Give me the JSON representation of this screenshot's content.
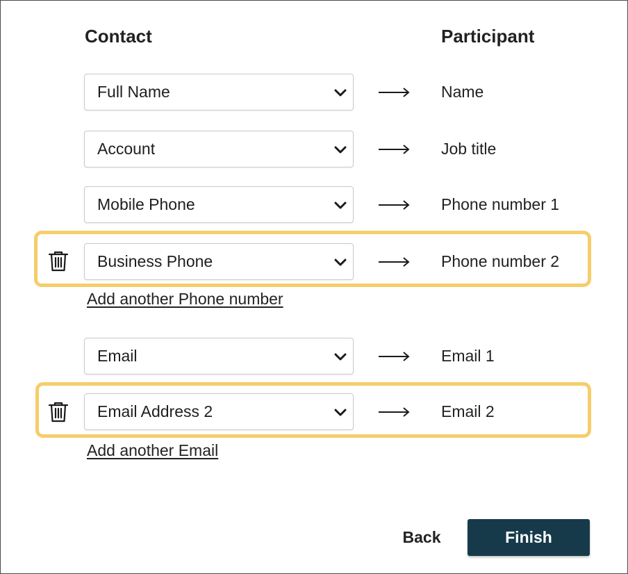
{
  "headers": {
    "contact": "Contact",
    "participant": "Participant"
  },
  "rows": [
    {
      "contact": "Full Name",
      "participant": "Name",
      "removable": false
    },
    {
      "contact": "Account",
      "participant": "Job title",
      "removable": false
    },
    {
      "contact": "Mobile Phone",
      "participant": "Phone number 1",
      "removable": false
    },
    {
      "contact": "Business Phone",
      "participant": "Phone number 2",
      "removable": true
    },
    {
      "contact": "Email",
      "participant": "Email 1",
      "removable": false
    },
    {
      "contact": "Email Address 2",
      "participant": "Email 2",
      "removable": true
    }
  ],
  "links": {
    "add_phone": "Add another Phone number",
    "add_email": "Add another Email"
  },
  "buttons": {
    "back": "Back",
    "finish": "Finish"
  },
  "icons": {
    "select": "chevron-down-icon",
    "mapping": "arrow-right-icon",
    "remove": "trash-icon"
  },
  "colors": {
    "highlight": "#f6cd6a",
    "primary_button": "#173a4b",
    "primary_button_text": "#ffffff",
    "text": "#222222"
  }
}
